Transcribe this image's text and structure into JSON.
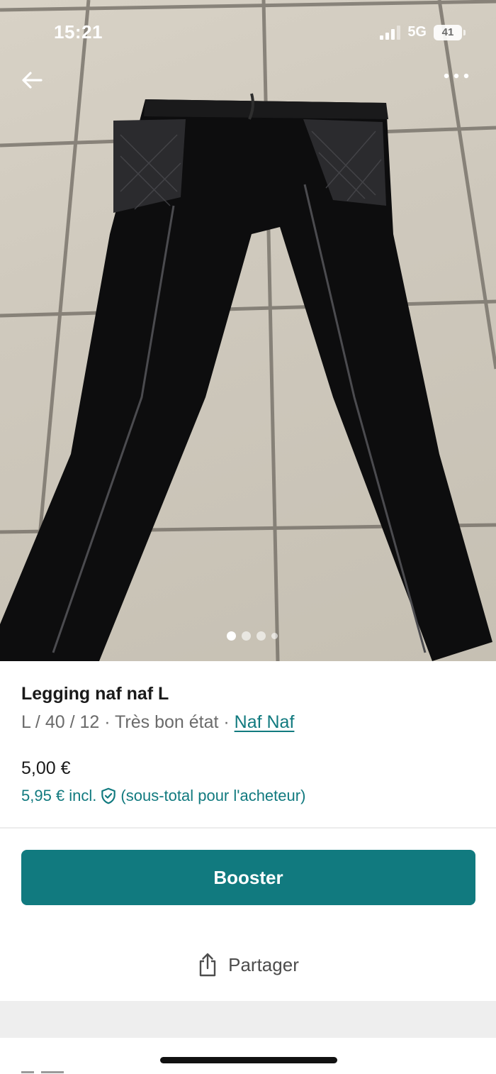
{
  "status_bar": {
    "time": "15:21",
    "network": "5G",
    "battery": "41"
  },
  "photo": {
    "carousel_count": 4,
    "active_index": 0
  },
  "item": {
    "title": "Legging naf naf L",
    "size": "L / 40 / 12",
    "sep1": " · ",
    "condition": "Très bon état",
    "sep2": " · ",
    "brand": "Naf Naf",
    "price": "5,00 €",
    "price_incl": "5,95 € incl.",
    "price_incl_note": "(sous-total pour l'acheteur)"
  },
  "actions": {
    "booster": "Booster",
    "share": "Partager"
  },
  "icons": {
    "back": "back-arrow-icon",
    "more": "more-dots-icon",
    "shield": "shield-check-icon",
    "share": "share-icon"
  },
  "colors": {
    "accent": "#117a7f"
  }
}
